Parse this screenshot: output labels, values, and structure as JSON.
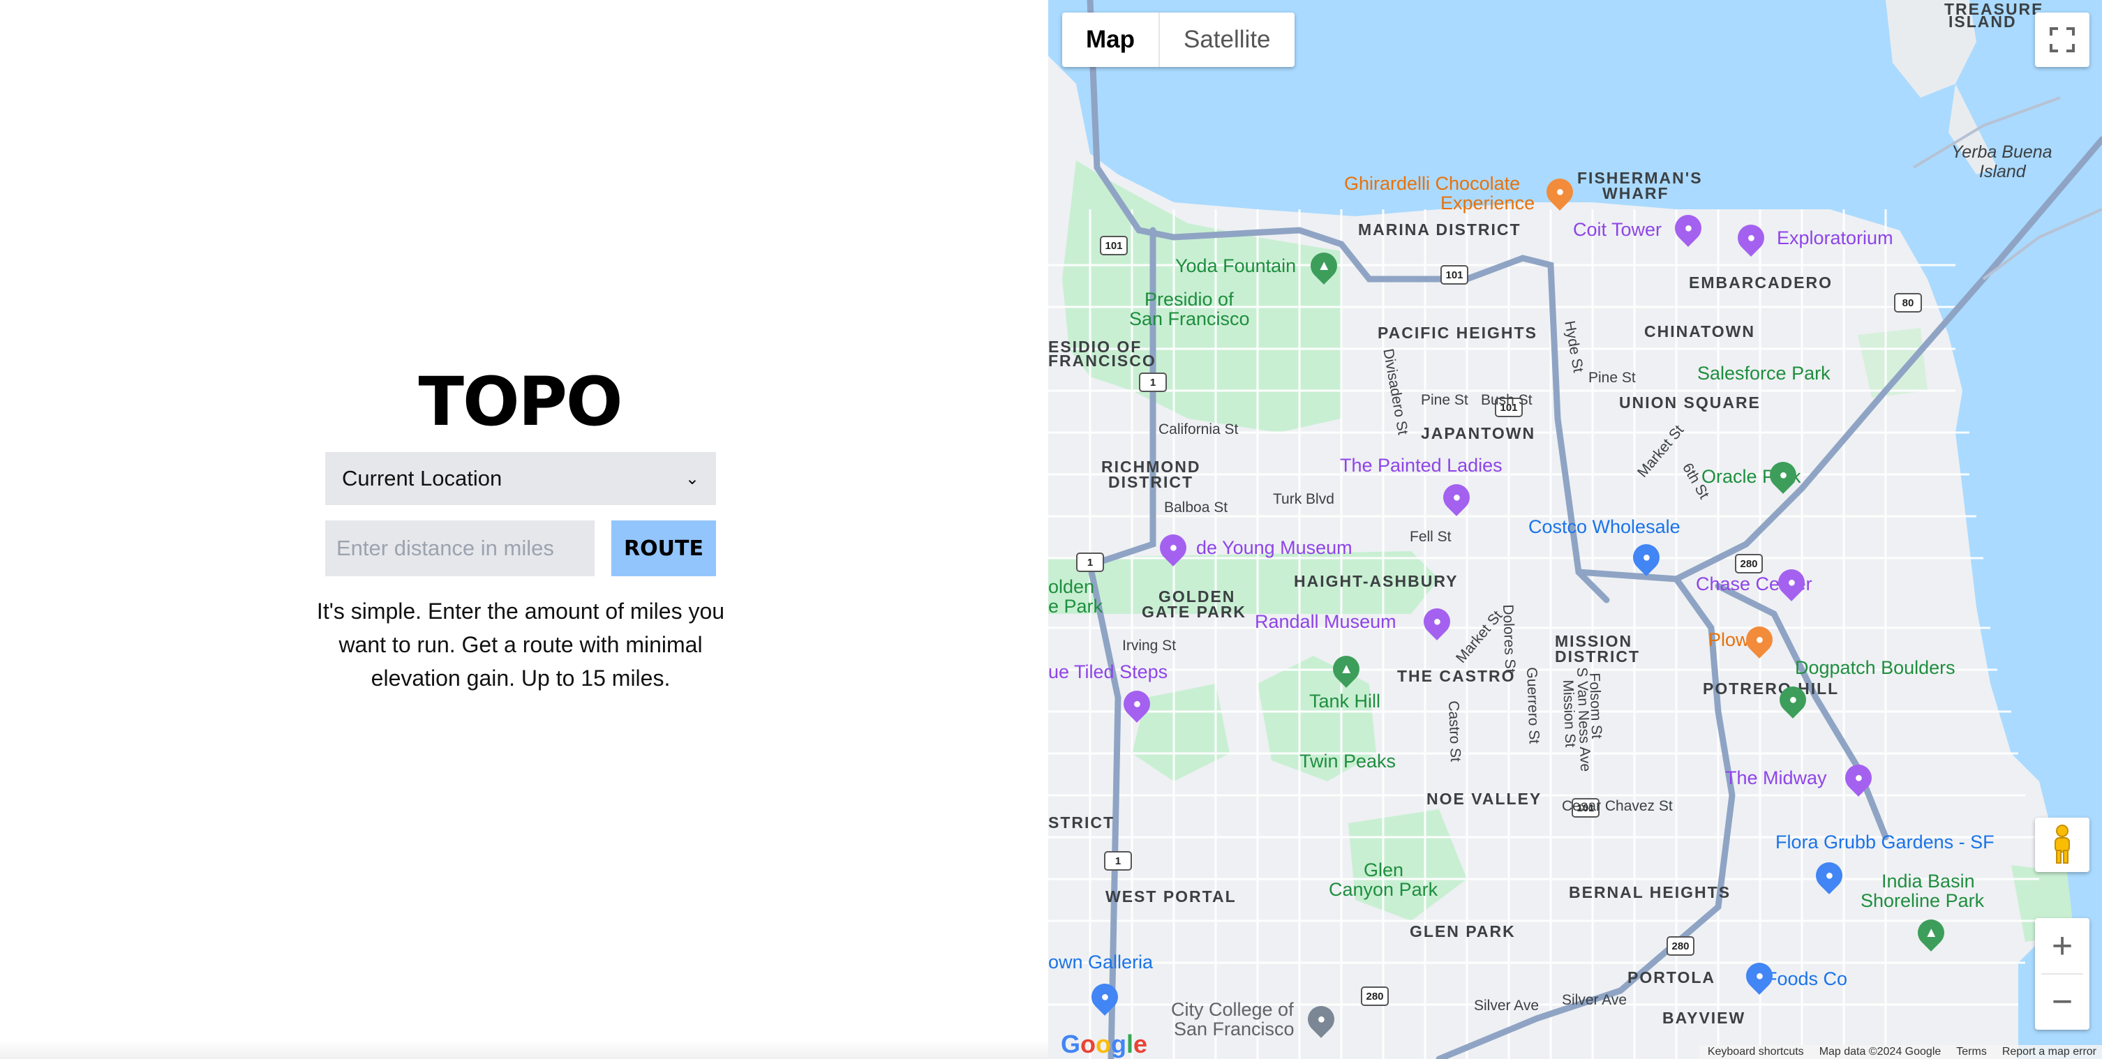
{
  "app": {
    "title": "TOPO",
    "location_select": {
      "selected": "Current Location"
    },
    "distance_input": {
      "value": "",
      "placeholder": "Enter distance in miles"
    },
    "route_button": "ROUTE",
    "description": "It's simple. Enter the amount of miles you want to run. Get a route with minimal elevation gain. Up to 15 miles."
  },
  "map": {
    "type_controls": {
      "map": "Map",
      "satellite": "Satellite",
      "selected": "Map"
    },
    "icons": {
      "fullscreen": "fullscreen-icon",
      "pegman": "pegman-icon",
      "zoom_in": "zoom-in-icon",
      "zoom_out": "zoom-out-icon"
    },
    "zoom_in_label": "+",
    "zoom_out_label": "−",
    "districts": {
      "treasure_island_1": "TREASURE",
      "treasure_island_2": "ISLAND",
      "fishermans_wharf_1": "FISHERMAN'S",
      "fishermans_wharf_2": "WHARF",
      "marina": "MARINA DISTRICT",
      "embarcadero": "EMBARCADERO",
      "pacific_heights": "PACIFIC HEIGHTS",
      "chinatown": "CHINATOWN",
      "presidio_1": "ESIDIO OF",
      "presidio_2": "FRANCISCO",
      "union_square": "UNION SQUARE",
      "japantown": "JAPANTOWN",
      "richmond_1": "RICHMOND",
      "richmond_2": "DISTRICT",
      "haight": "HAIGHT-ASHBURY",
      "golden_gate_park_1": "GOLDEN",
      "golden_gate_park_2": "GATE PARK",
      "mission_1": "MISSION",
      "mission_2": "DISTRICT",
      "castro": "THE CASTRO",
      "potrero": "POTRERO HILL",
      "noe_valley": "NOE VALLEY",
      "sunset_district": "STRICT",
      "west_portal": "WEST PORTAL",
      "bernal": "BERNAL HEIGHTS",
      "glen_park": "GLEN PARK",
      "portola": "PORTOLA",
      "bayview": "BAYVIEW"
    },
    "pois": {
      "ghirardelli_1": "Ghirardelli Chocolate",
      "ghirardelli_2": "Experience",
      "coit": "Coit Tower",
      "exploratorium": "Exploratorium",
      "yoda": "Yoda Fountain",
      "presidio_sf_1": "Presidio of",
      "presidio_sf_2": "San Francisco",
      "salesforce": "Salesforce Park",
      "painted_ladies": "The Painted Ladies",
      "oracle": "Oracle Park",
      "costco": "Costco Wholesale",
      "de_young": "de Young Museum",
      "chase": "Chase Center",
      "golden_gate_park_west_1": "olden",
      "golden_gate_park_west_2": "e Park",
      "randall": "Randall Museum",
      "plow": "Plow",
      "dogpatch": "Dogpatch Boulders",
      "tiled_steps": "ue Tiled Steps",
      "tank_hill": "Tank Hill",
      "twin_peaks": "Twin Peaks",
      "midway": "The Midway",
      "flora_grubb": "Flora Grubb Gardens - SF",
      "india_basin_1": "India Basin",
      "india_basin_2": "Shoreline Park",
      "glen_canyon_1": "Glen",
      "glen_canyon_2": "Canyon Park",
      "stonestown": "own Galleria",
      "foods_co": "Foods Co",
      "ccsf_1": "City College of",
      "ccsf_2": "San Francisco",
      "yerba_buena_1": "Yerba Buena",
      "yerba_buena_2": "Island"
    },
    "streets": {
      "hyde": "Hyde St",
      "divisadero": "Divisadero St",
      "pine1": "Pine St",
      "bush": "Bush St",
      "pine2": "Pine St",
      "california": "California St",
      "market1": "Market St",
      "sixth": "6th St",
      "balboa": "Balboa St",
      "turk": "Turk Blvd",
      "fell": "Fell St",
      "irving": "Irving St",
      "market2": "Market St",
      "dolores": "Dolores St",
      "guerrero": "Guerrero St",
      "castro": "Castro St",
      "folsom": "Folsom St",
      "van_ness": "S Van Ness Ave",
      "mission": "Mission St",
      "cesar_chavez": "Cesar Chavez St",
      "silver1": "Silver Ave",
      "silver2": "Silver Ave"
    },
    "shields": {
      "s101": "101",
      "s1": "1",
      "s80": "80",
      "s280": "280"
    },
    "google": {
      "g": "G",
      "o1": "o",
      "o2": "o",
      "g2": "g",
      "l": "l",
      "e": "e"
    },
    "attribution": {
      "shortcuts": "Keyboard shortcuts",
      "data": "Map data ©2024 Google",
      "terms": "Terms",
      "report": "Report a map error"
    }
  }
}
